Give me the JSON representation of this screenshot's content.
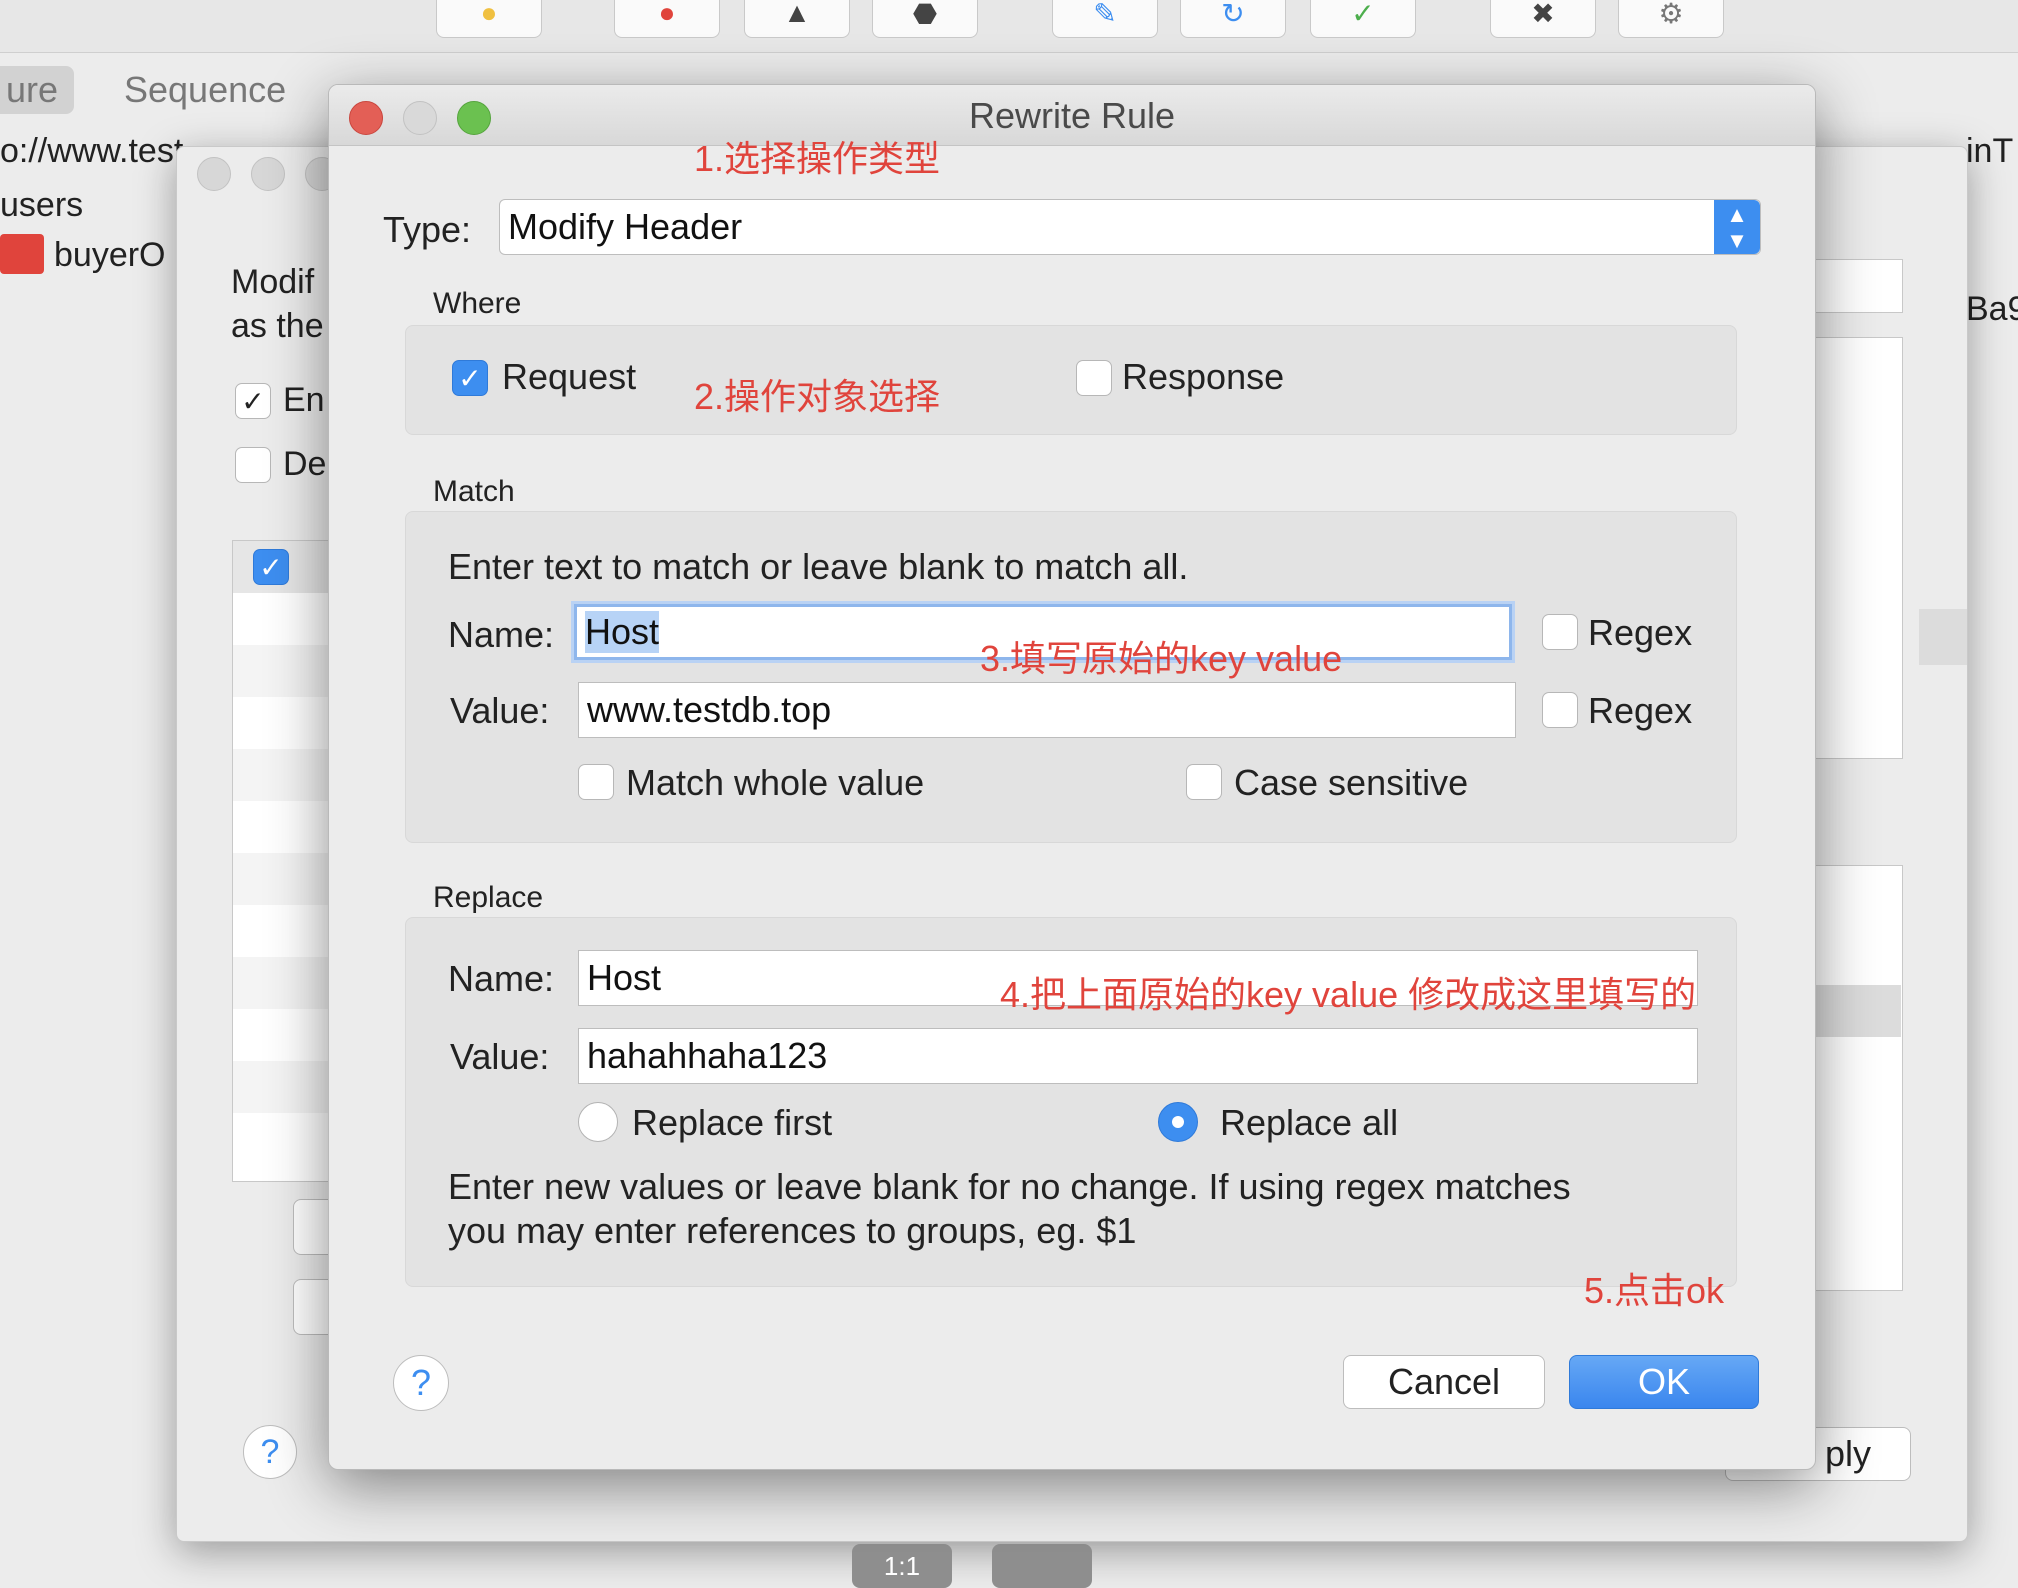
{
  "background": {
    "tabs": [
      "ure",
      "Sequence"
    ],
    "url_fragment": "o://www.test",
    "tree_items": [
      "users",
      "buyerO"
    ],
    "dialog_text": [
      "Modif",
      "as the"
    ],
    "checkbox_labels": [
      "En",
      "De"
    ],
    "right_fragments": [
      "inT",
      "Ba9"
    ],
    "apply_label": "ply",
    "bottom_buttons": [
      "1:1"
    ]
  },
  "dialog": {
    "title": "Rewrite Rule",
    "type_label": "Type:",
    "type_value": "Modify Header",
    "where": {
      "section": "Where",
      "request_label": "Request",
      "request_checked": true,
      "response_label": "Response",
      "response_checked": false
    },
    "match": {
      "section": "Match",
      "hint": "Enter text to match or leave blank to match all.",
      "name_label": "Name:",
      "name_value": "Host",
      "value_label": "Value:",
      "value_value": "www.testdb.top",
      "regex_label": "Regex",
      "whole_value_label": "Match whole value",
      "case_sensitive_label": "Case sensitive"
    },
    "replace": {
      "section": "Replace",
      "name_label": "Name:",
      "name_value": "Host",
      "value_label": "Value:",
      "value_value": "hahahhaha123",
      "replace_first_label": "Replace first",
      "replace_all_label": "Replace all",
      "selected": "Replace all",
      "hint_line1": "Enter new values or leave blank for no change. If using regex matches",
      "hint_line2": "you may enter references to groups, eg. $1"
    },
    "help": "?",
    "cancel_label": "Cancel",
    "ok_label": "OK"
  },
  "annotations": {
    "a1": "1.选择操作类型",
    "a2": "2.操作对象选择",
    "a3": "3.填写原始的key value",
    "a4": "4.把上面原始的key value 修改成这里填写的",
    "a5": "5.点击ok"
  },
  "colors": {
    "accent": "#3d8ef0",
    "annotation": "#e0443c",
    "close": "#e35f56",
    "minimize": "#d9d9d9",
    "zoom": "#6bc150"
  }
}
